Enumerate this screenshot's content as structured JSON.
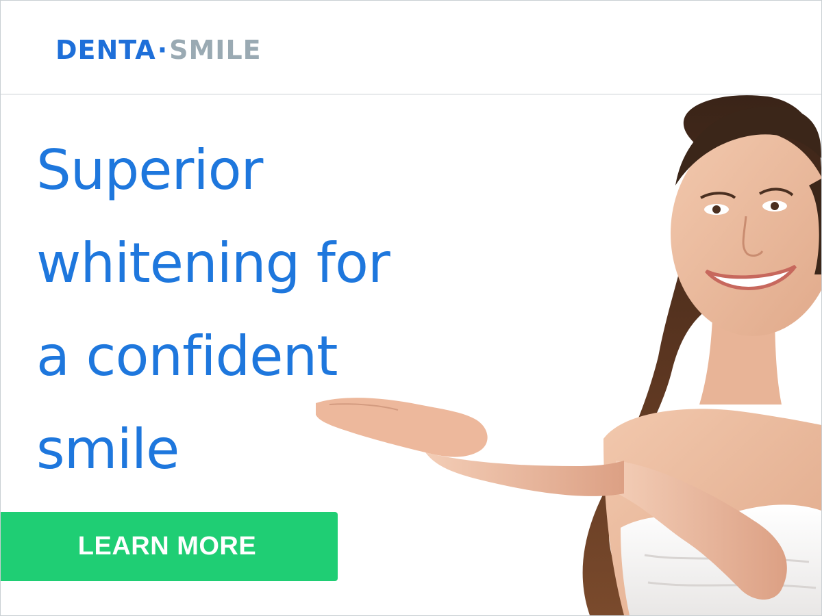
{
  "brand": {
    "part1": "DENTA",
    "separator": "·",
    "part2": "SMILE",
    "color_primary": "#1e6fd9",
    "color_secondary": "#9aaab3"
  },
  "headline": {
    "lines": [
      "Superior",
      "whitening for",
      "a confident",
      "smile"
    ],
    "color": "#1e77dd"
  },
  "cta": {
    "label": "LEARN MORE",
    "background": "#1fce74"
  },
  "image": {
    "subject": "smiling-woman-presenting-hand"
  }
}
